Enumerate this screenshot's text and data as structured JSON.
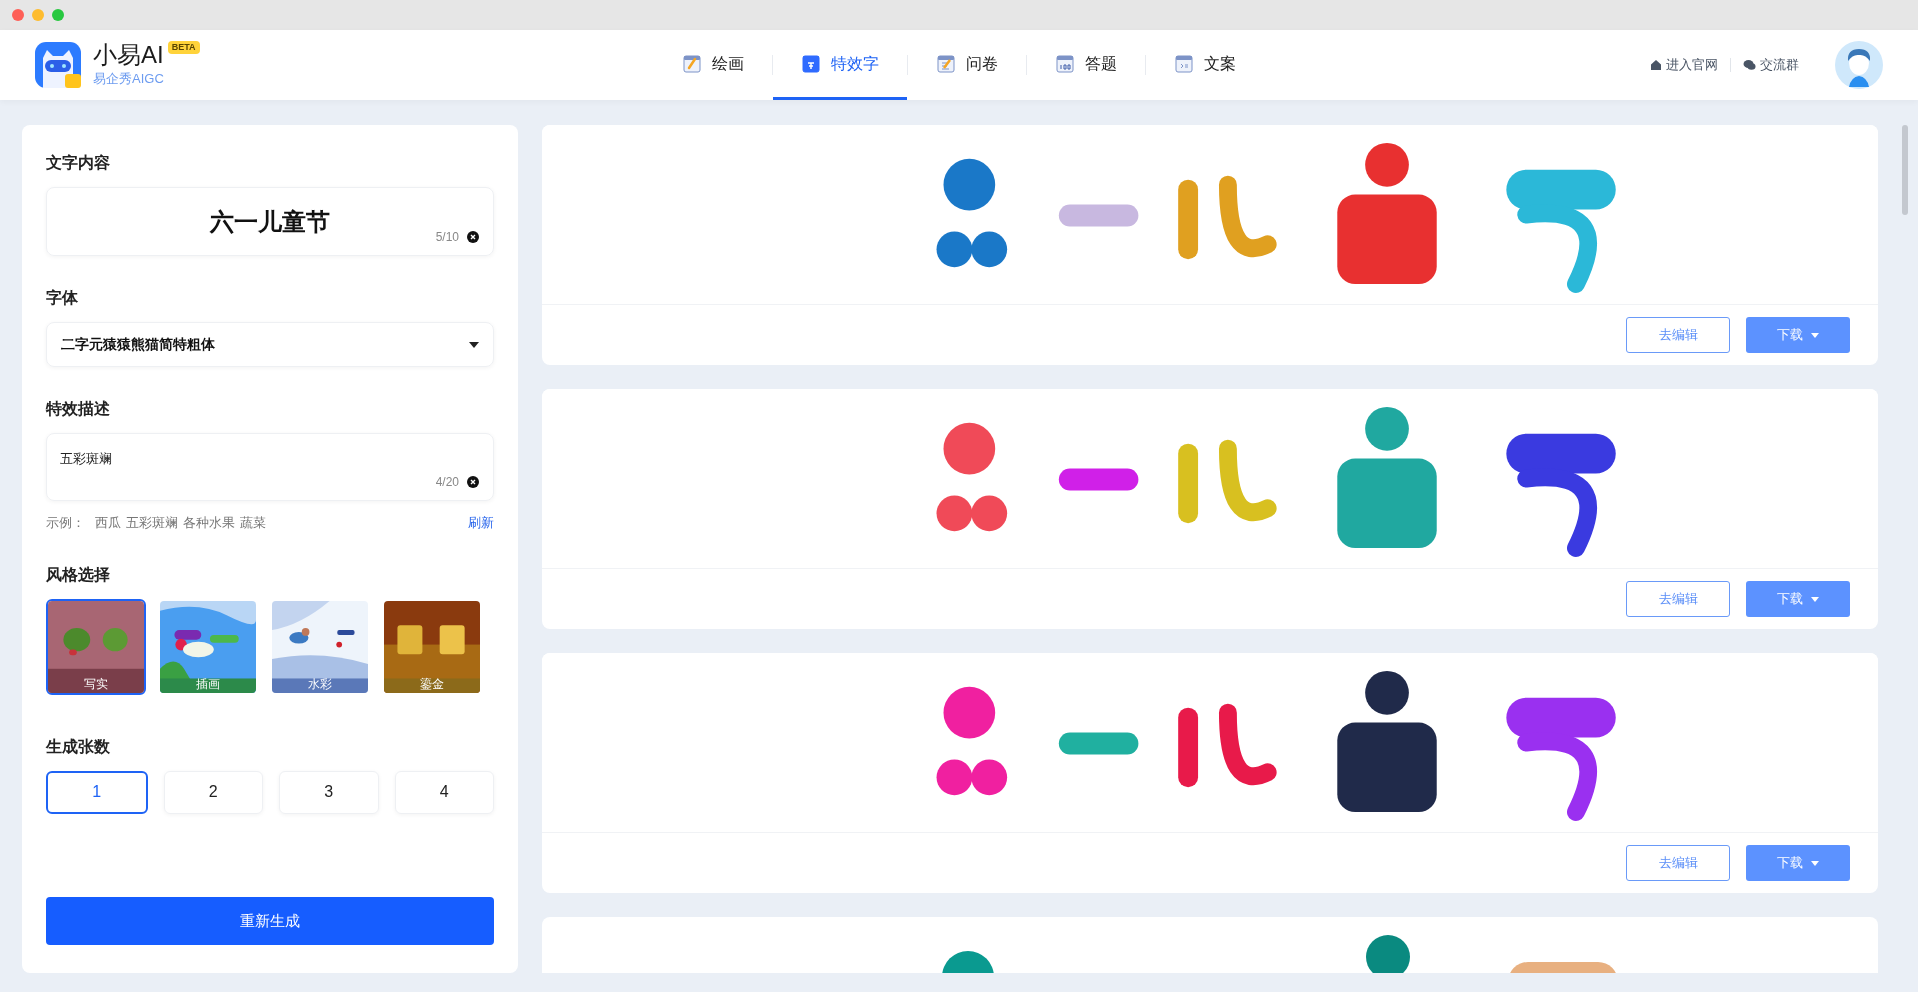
{
  "app": {
    "name": "小易AI",
    "badge": "BETA",
    "subtitle": "易企秀AIGC"
  },
  "nav": [
    {
      "label": "绘画",
      "kind": "brush",
      "selected": false
    },
    {
      "label": "特效字",
      "kind": "glyph",
      "selected": true
    },
    {
      "label": "问卷",
      "kind": "pencil",
      "selected": false
    },
    {
      "label": "答题",
      "kind": "score",
      "selected": false
    },
    {
      "label": "文案",
      "kind": "doc",
      "selected": false
    }
  ],
  "header_links": [
    {
      "label": "进入官网",
      "kind": "home"
    },
    {
      "label": "交流群",
      "kind": "chat"
    }
  ],
  "form": {
    "text_label": "文字内容",
    "text_value": "六一儿童节",
    "text_count": "5/10",
    "font_label": "字体",
    "font_value": "二字元猿猿熊猫简特粗体",
    "desc_label": "特效描述",
    "desc_value": "五彩斑斓",
    "desc_count": "4/20",
    "example_label": "示例：",
    "examples": [
      "西瓜",
      "五彩斑斓",
      "各种水果",
      "蔬菜"
    ],
    "refresh": "刷新",
    "style_label": "风格选择",
    "styles": [
      {
        "label": "写实",
        "selected": true
      },
      {
        "label": "插画",
        "selected": false
      },
      {
        "label": "水彩",
        "selected": false
      },
      {
        "label": "鎏金",
        "selected": false
      }
    ],
    "count_label": "生成张数",
    "counts": [
      {
        "label": "1",
        "selected": true
      },
      {
        "label": "2",
        "selected": false
      },
      {
        "label": "3",
        "selected": false
      },
      {
        "label": "4",
        "selected": false
      }
    ],
    "submit": "重新生成"
  },
  "results": [
    {
      "kind": "card",
      "edit": "去编辑",
      "download": "下载"
    },
    {
      "kind": "card",
      "edit": "去编辑",
      "download": "下载"
    },
    {
      "kind": "card",
      "edit": "去编辑",
      "download": "下载"
    },
    {
      "kind": "picture"
    }
  ]
}
